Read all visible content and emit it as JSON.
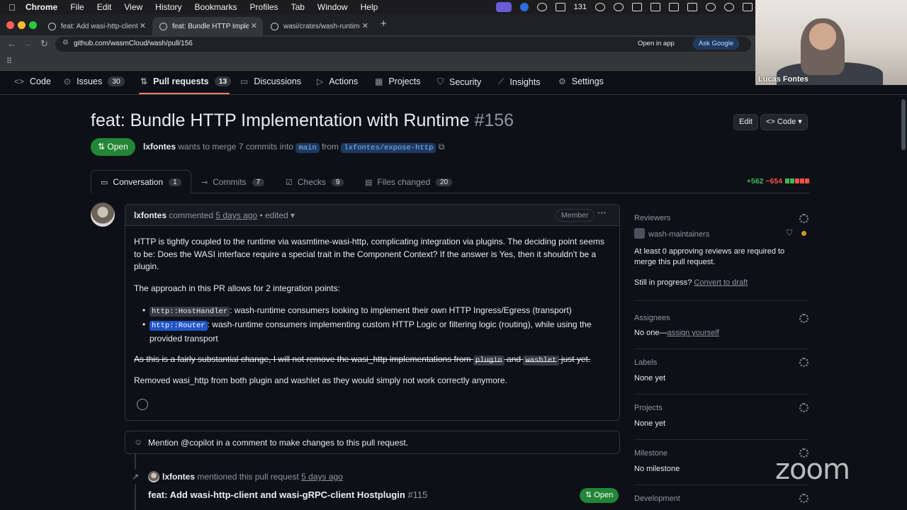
{
  "menubar": {
    "app": "Chrome",
    "items": [
      "File",
      "Edit",
      "View",
      "History",
      "Bookmarks",
      "Profiles",
      "Tab",
      "Window",
      "Help"
    ],
    "tray_count": "131"
  },
  "tabs": [
    {
      "title": "feat: Add wasi-http-client an"
    },
    {
      "title": "feat: Bundle HTTP Implemen"
    },
    {
      "title": "wasi/crates/wash-runtime/R"
    }
  ],
  "addressbar": {
    "url": "github.com/wasmCloud/wash/pull/156",
    "open_in_app": "Open in app",
    "ask_google": "Ask Google"
  },
  "repo_nav": {
    "items": [
      {
        "label": "Code",
        "icon": "code-icon",
        "count": ""
      },
      {
        "label": "Issues",
        "icon": "issue-icon",
        "count": "30"
      },
      {
        "label": "Pull requests",
        "icon": "pr-icon",
        "count": "13"
      },
      {
        "label": "Discussions",
        "icon": "discussion-icon",
        "count": ""
      },
      {
        "label": "Actions",
        "icon": "play-icon",
        "count": ""
      },
      {
        "label": "Projects",
        "icon": "table-icon",
        "count": ""
      },
      {
        "label": "Security",
        "icon": "shield-icon",
        "count": ""
      },
      {
        "label": "Insights",
        "icon": "graph-icon",
        "count": ""
      },
      {
        "label": "Settings",
        "icon": "gear-icon",
        "count": ""
      }
    ]
  },
  "pr": {
    "title": "feat: Bundle HTTP Implementation with Runtime",
    "number": "#156",
    "edit_label": "Edit",
    "code_label": "Code",
    "state": "Open",
    "author": "lxfontes",
    "merge_text": "wants to merge 7 commits into",
    "base_branch": "main",
    "from_text": "from",
    "head_branch": "lxfontes/expose-http"
  },
  "pr_tabs": [
    {
      "label": "Conversation",
      "count": "1"
    },
    {
      "label": "Commits",
      "count": "7"
    },
    {
      "label": "Checks",
      "count": "9"
    },
    {
      "label": "Files changed",
      "count": "20"
    }
  ],
  "diffstat": {
    "additions": "+562",
    "deletions": "−654"
  },
  "comment": {
    "author": "lxfontes",
    "action": "commented",
    "time": "5 days ago",
    "edited": "• edited",
    "badge": "Member",
    "para1": "HTTP is tightly coupled to the runtime via wasmtime-wasi-http, complicating integration via plugins. The deciding point seems to be: Does the WASI interface require a special trait in the Component Context? If the answer is Yes, then it shouldn't be a plugin.",
    "para2": "The approach in this PR allows for 2 integration points:",
    "item1_code": "http::HostHandler",
    "item1_text": ": wash-runtime consumers looking to implement their own HTTP Ingress/Egress (transport)",
    "item2_code": "http::Router",
    "item2_text": ": wash-runtime consumers implementing custom HTTP Logic or filtering logic (routing), while using the provided transport",
    "strike_a": "As this is a fairly substantial change, I will not remove the wasi_http implementations from",
    "strike_code1": "plugin",
    "strike_b": "and",
    "strike_code2": "washlet",
    "strike_c": "just yet.",
    "para4": "Removed wasi_http from both plugin and washlet as they would simply not work correctly anymore."
  },
  "copilot_hint": "Mention @copilot in a comment to make changes to this pull request.",
  "timeline": {
    "author": "lxfontes",
    "text": "mentioned this pull request",
    "time": "5 days ago",
    "ref_title": "feat: Add wasi-http-client and wasi-gRPC-client Hostplugin",
    "ref_number": "#115",
    "ref_state": "Open"
  },
  "sidebar": {
    "reviewers_label": "Reviewers",
    "reviewer_team": "wash-maintainers",
    "review_note": "At least 0 approving reviews are required to merge this pull request.",
    "progress_q": "Still in progress?",
    "convert_draft": "Convert to draft",
    "assignees_label": "Assignees",
    "assignees_none": "No one—",
    "assign_yourself": "assign yourself",
    "labels_label": "Labels",
    "labels_value": "None yet",
    "projects_label": "Projects",
    "projects_value": "None yet",
    "milestone_label": "Milestone",
    "milestone_value": "No milestone",
    "development_label": "Development"
  },
  "video": {
    "participant": "Lucas Fontes",
    "logo": "zoom"
  },
  "colors": {
    "bg": "#0d1117",
    "open_green": "#238636",
    "accent_underline": "#f78166",
    "add": "#3fb950",
    "del": "#f85149"
  }
}
